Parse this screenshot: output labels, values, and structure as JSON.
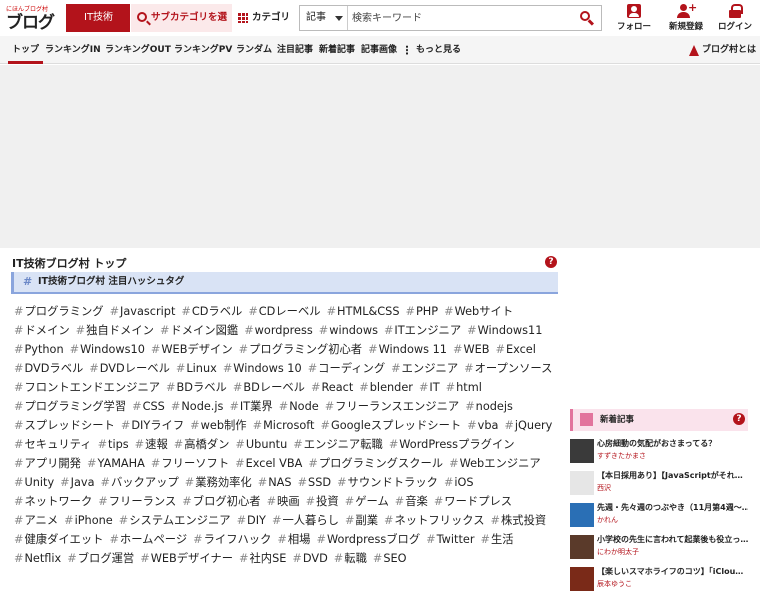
{
  "header": {
    "logo_small": "にほんブログ村",
    "logo_big": "ブログ村",
    "category_button": "IT技術",
    "sub_button": "サブカテゴリを選ぶ",
    "category_label": "カテゴリ",
    "search_select": "記事",
    "search_placeholder": "検索キーワード",
    "follow": "フォロー",
    "register": "新規登録",
    "login": "ログイン"
  },
  "nav": {
    "items": [
      "トップ",
      "ランキングIN",
      "ランキングOUT",
      "ランキングPV",
      "ランダム",
      "注目記事",
      "新着記事",
      "記事画像",
      "もっと見る"
    ],
    "about": "ブログ村とは"
  },
  "main": {
    "title": "IT技術ブログ村 トップ",
    "hashtag_heading": "IT技術ブログ村 注目ハッシュタグ",
    "hashtag_mark": "#",
    "tags": [
      "プログラミング",
      "Javascript",
      "CDラベル",
      "CDレーベル",
      "HTML&CSS",
      "PHP",
      "Webサイト",
      "ドメイン",
      "独自ドメイン",
      "ドメイン図鑑",
      "wordpress",
      "windows",
      "ITエンジニア",
      "Windows11",
      "Python",
      "Windows10",
      "WEBデザイン",
      "プログラミング初心者",
      "Windows 11",
      "WEB",
      "Excel",
      "DVDラベル",
      "DVDレーベル",
      "Linux",
      "Windows 10",
      "コーディング",
      "エンジニア",
      "オープンソース",
      "フロントエンドエンジニア",
      "BDラベル",
      "BDレーベル",
      "React",
      "blender",
      "IT",
      "html",
      "プログラミング学習",
      "CSS",
      "Node.js",
      "IT業界",
      "Node",
      "フリーランスエンジニア",
      "nodejs",
      "スプレッドシート",
      "DIYライフ",
      "web制作",
      "Microsoft",
      "Googleスプレッドシート",
      "vba",
      "jQuery",
      "セキュリティ",
      "tips",
      "速報",
      "高橋ダン",
      "Ubuntu",
      "エンジニア転職",
      "WordPressプラグイン",
      "アプリ開発",
      "YAMAHA",
      "フリーソフト",
      "Excel VBA",
      "プログラミングスクール",
      "Webエンジニア",
      "Unity",
      "Java",
      "バックアップ",
      "業務効率化",
      "NAS",
      "SSD",
      "サウンドトラック",
      "iOS",
      "ネットワーク",
      "フリーランス",
      "ブログ初心者",
      "映画",
      "投資",
      "ゲーム",
      "音楽",
      "ワードプレス",
      "アニメ",
      "iPhone",
      "システムエンジニア",
      "DIY",
      "一人暮らし",
      "副業",
      "ネットフリックス",
      "株式投資",
      "健康ダイエット",
      "ホームページ",
      "ライフハック",
      "相場",
      "Wordpressブログ",
      "Twitter",
      "生活",
      "Netflix",
      "ブログ運営",
      "WEBデザイナー",
      "社内SE",
      "DVD",
      "転職",
      "SEO"
    ]
  },
  "new_articles": {
    "heading": "新着記事",
    "items": [
      {
        "title": "心房細動の気配がおさまってる？",
        "author": "すずきたかまさ",
        "color": "#3a3a3a"
      },
      {
        "title": "【本日採用あり】【JavaScriptがそれ…",
        "author": "西沢",
        "color": "#e6e6e6"
      },
      {
        "title": "先週・先々週のつぶやき（11月第4週～…",
        "author": "かれん",
        "color": "#2a6fb5"
      },
      {
        "title": "小学校の先生に言われて起業後も役立っ…",
        "author": "にわか明太子",
        "color": "#5a3a2a"
      },
      {
        "title": "【楽しいスマホライフのコツ】「iClou…",
        "author": "辰本ゆうこ",
        "color": "#7a2a18"
      }
    ]
  },
  "colors": {
    "accent": "#b3131b",
    "tag_hash": "#888888",
    "heading_bg": "#d9e3f5",
    "new_heading_bg": "#fae3ec"
  }
}
